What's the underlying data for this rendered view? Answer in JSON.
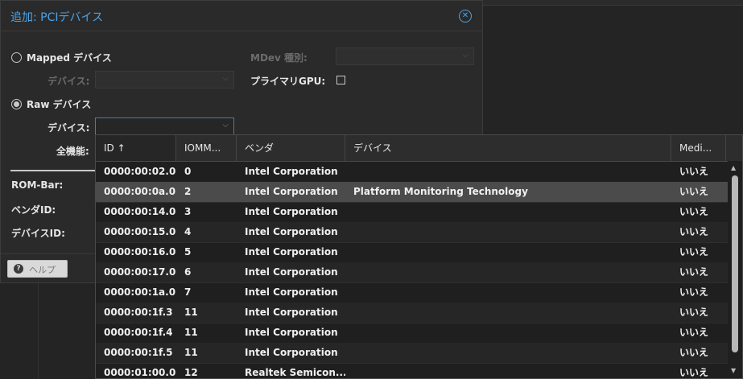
{
  "dialog": {
    "title": "追加: PCIデバイス",
    "mapped_label": "Mapped デバイス",
    "mapped_device_label": "デバイス:",
    "mdev_label": "MDev 種別:",
    "primary_gpu_label": "プライマリGPU:",
    "raw_label": "Raw デバイス",
    "raw_device_label": "デバイス:",
    "all_functions_label": "全機能:",
    "rom_bar_label": "ROM-Bar:",
    "vendor_id_label": "ベンダID:",
    "device_id_label": "デバイスID:",
    "help_label": "ヘルプ"
  },
  "grid": {
    "columns": [
      "ID ↑",
      "IOMM...",
      "ベンダ",
      "デバイス",
      "Medi..."
    ],
    "rows": [
      [
        "0000:00:02.0",
        "0",
        "Intel Corporation",
        "",
        "いいえ"
      ],
      [
        "0000:00:0a.0",
        "2",
        "Intel Corporation",
        "Platform Monitoring Technology",
        "いいえ"
      ],
      [
        "0000:00:14.0",
        "3",
        "Intel Corporation",
        "",
        "いいえ"
      ],
      [
        "0000:00:15.0",
        "4",
        "Intel Corporation",
        "",
        "いいえ"
      ],
      [
        "0000:00:16.0",
        "5",
        "Intel Corporation",
        "",
        "いいえ"
      ],
      [
        "0000:00:17.0",
        "6",
        "Intel Corporation",
        "",
        "いいえ"
      ],
      [
        "0000:00:1a.0",
        "7",
        "Intel Corporation",
        "",
        "いいえ"
      ],
      [
        "0000:00:1f.3",
        "11",
        "Intel Corporation",
        "",
        "いいえ"
      ],
      [
        "0000:00:1f.4",
        "11",
        "Intel Corporation",
        "",
        "いいえ"
      ],
      [
        "0000:00:1f.5",
        "11",
        "Intel Corporation",
        "",
        "いいえ"
      ],
      [
        "0000:01:00.0",
        "12",
        "Realtek Semicon...",
        "",
        "いいえ"
      ]
    ],
    "selected_row": 1
  },
  "colors": {
    "accent": "#4aa3e8",
    "selected_row": "#4b4b4b"
  }
}
